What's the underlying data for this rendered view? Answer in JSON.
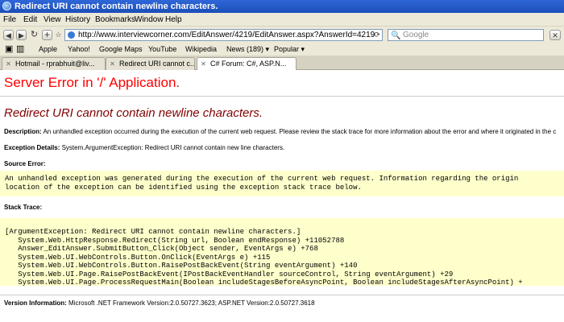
{
  "window": {
    "title": "Redirect URI cannot contain newline characters."
  },
  "menu": [
    "File",
    "Edit",
    "View",
    "History",
    "Bookmarks",
    "Window",
    "Help"
  ],
  "nav": {
    "url": "http://www.interviewcorner.com/EditAnswer/4219/EditAnswer.aspx?AnswerId=4219",
    "search_placeholder": "Google"
  },
  "bookmarks": [
    "Apple",
    "Yahoo!",
    "Google Maps",
    "YouTube",
    "Wikipedia",
    "News (189) ▾",
    "Popular ▾"
  ],
  "tabs": [
    {
      "label": "Hotmail - rprabhuit@liv..."
    },
    {
      "label": "Redirect URI cannot c..."
    },
    {
      "label": "C# Forum: C#, ASP.N..."
    }
  ],
  "page": {
    "server_error": "Server Error in '/' Application.",
    "error_title": "Redirect URI cannot contain newline characters.",
    "description_label": "Description:",
    "description_text": "An unhandled exception occurred during the execution of the current web request. Please review the stack trace for more information about the error and where it originated in the c",
    "exception_label": "Exception Details:",
    "exception_text": "System.ArgumentException: Redirect URI cannot contain new line characters.",
    "source_error_label": "Source Error:",
    "source_error_lines": [
      "An unhandled exception was generated during the execution of the current web request. Information regarding the origin",
      "location of the exception can be identified using the exception stack trace below."
    ],
    "stack_trace_label": "Stack Trace:",
    "stack_trace_lines": [
      "[ArgumentException: Redirect URI cannot contain newline characters.]",
      "   System.Web.HttpResponse.Redirect(String url, Boolean endResponse) +11052788",
      "   Answer_EditAnswer.SubmitButton_Click(Object sender, EventArgs e) +768",
      "   System.Web.UI.WebControls.Button.OnClick(EventArgs e) +115",
      "   System.Web.UI.WebControls.Button.RaisePostBackEvent(String eventArgument) +140",
      "   System.Web.UI.Page.RaisePostBackEvent(IPostBackEventHandler sourceControl, String eventArgument) +29",
      "   System.Web.UI.Page.ProcessRequestMain(Boolean includeStagesBeforeAsyncPoint, Boolean includeStagesAfterAsyncPoint) +"
    ],
    "version_label": "Version Information:",
    "version_text": "Microsoft .NET Framework Version:2.0.50727.3623; ASP.NET Version:2.0.50727.3618"
  }
}
